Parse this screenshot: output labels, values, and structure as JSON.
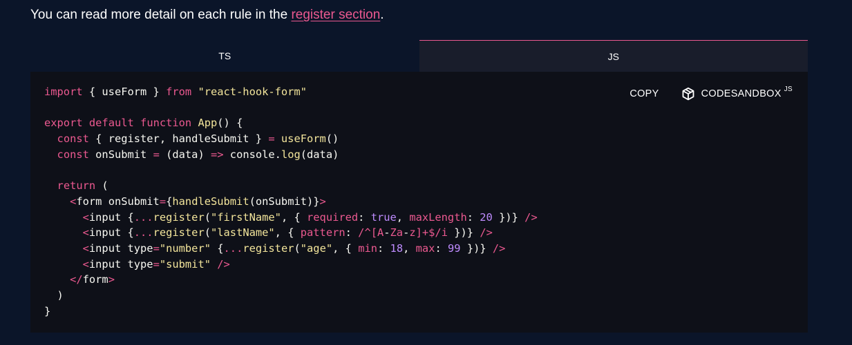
{
  "intro": {
    "text": "You can read more detail on each rule in the ",
    "link_text": "register section",
    "suffix": "."
  },
  "tabs": [
    {
      "label": "TS",
      "active": false
    },
    {
      "label": "JS",
      "active": true
    }
  ],
  "toolbar": {
    "copy_label": "COPY",
    "codesandbox_label": "CODESANDBOX",
    "codesandbox_suffix": "JS",
    "icon": "codesandbox-cube-icon"
  },
  "code": {
    "language": "js",
    "lines": [
      "import { useForm } from \"react-hook-form\"",
      "",
      "export default function App() {",
      "  const { register, handleSubmit } = useForm()",
      "  const onSubmit = (data) => console.log(data)",
      "",
      "  return (",
      "    <form onSubmit={handleSubmit(onSubmit)}>",
      "      <input {...register(\"firstName\", { required: true, maxLength: 20 })} />",
      "      <input {...register(\"lastName\", { pattern: /^[A-Za-z]+$/i })} />",
      "      <input type=\"number\" {...register(\"age\", { min: 18, max: 99 })} />",
      "      <input type=\"submit\" />",
      "    </form>",
      "  )",
      "}"
    ]
  },
  "colors": {
    "page_bg": "#0b1529",
    "code_bg": "#0e1018",
    "accent": "#ec5990",
    "string": "#f3e59b",
    "number": "#bf8cff"
  }
}
